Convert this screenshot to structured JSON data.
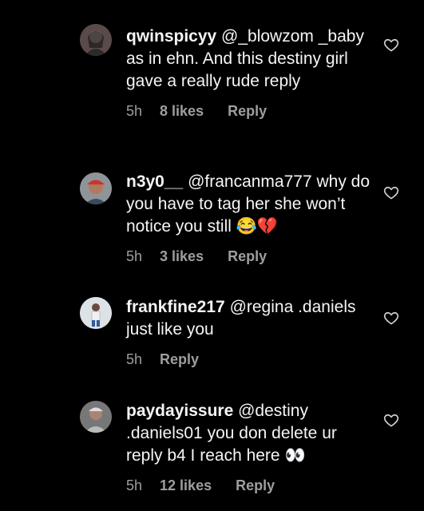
{
  "comments": [
    {
      "user": "qwinspicyy",
      "text": " @_blowzom _baby as in ehn. And this destiny girl gave a really rude reply",
      "time": "5h",
      "likes": "8 likes",
      "reply": "Reply"
    },
    {
      "user": "n3y0__",
      "text": " @francanma777 why do you have to tag her she won’t notice you still 😂💔",
      "time": "5h",
      "likes": "3 likes",
      "reply": "Reply"
    },
    {
      "user": "frankfine217",
      "text": " @regina .daniels just like you",
      "time": "5h",
      "likes": "",
      "reply": "Reply"
    },
    {
      "user": "paydayissure",
      "text": " @destiny .daniels01 you don delete ur reply b4 I reach here 👀",
      "time": "5h",
      "likes": "12 likes",
      "reply": "Reply"
    }
  ]
}
